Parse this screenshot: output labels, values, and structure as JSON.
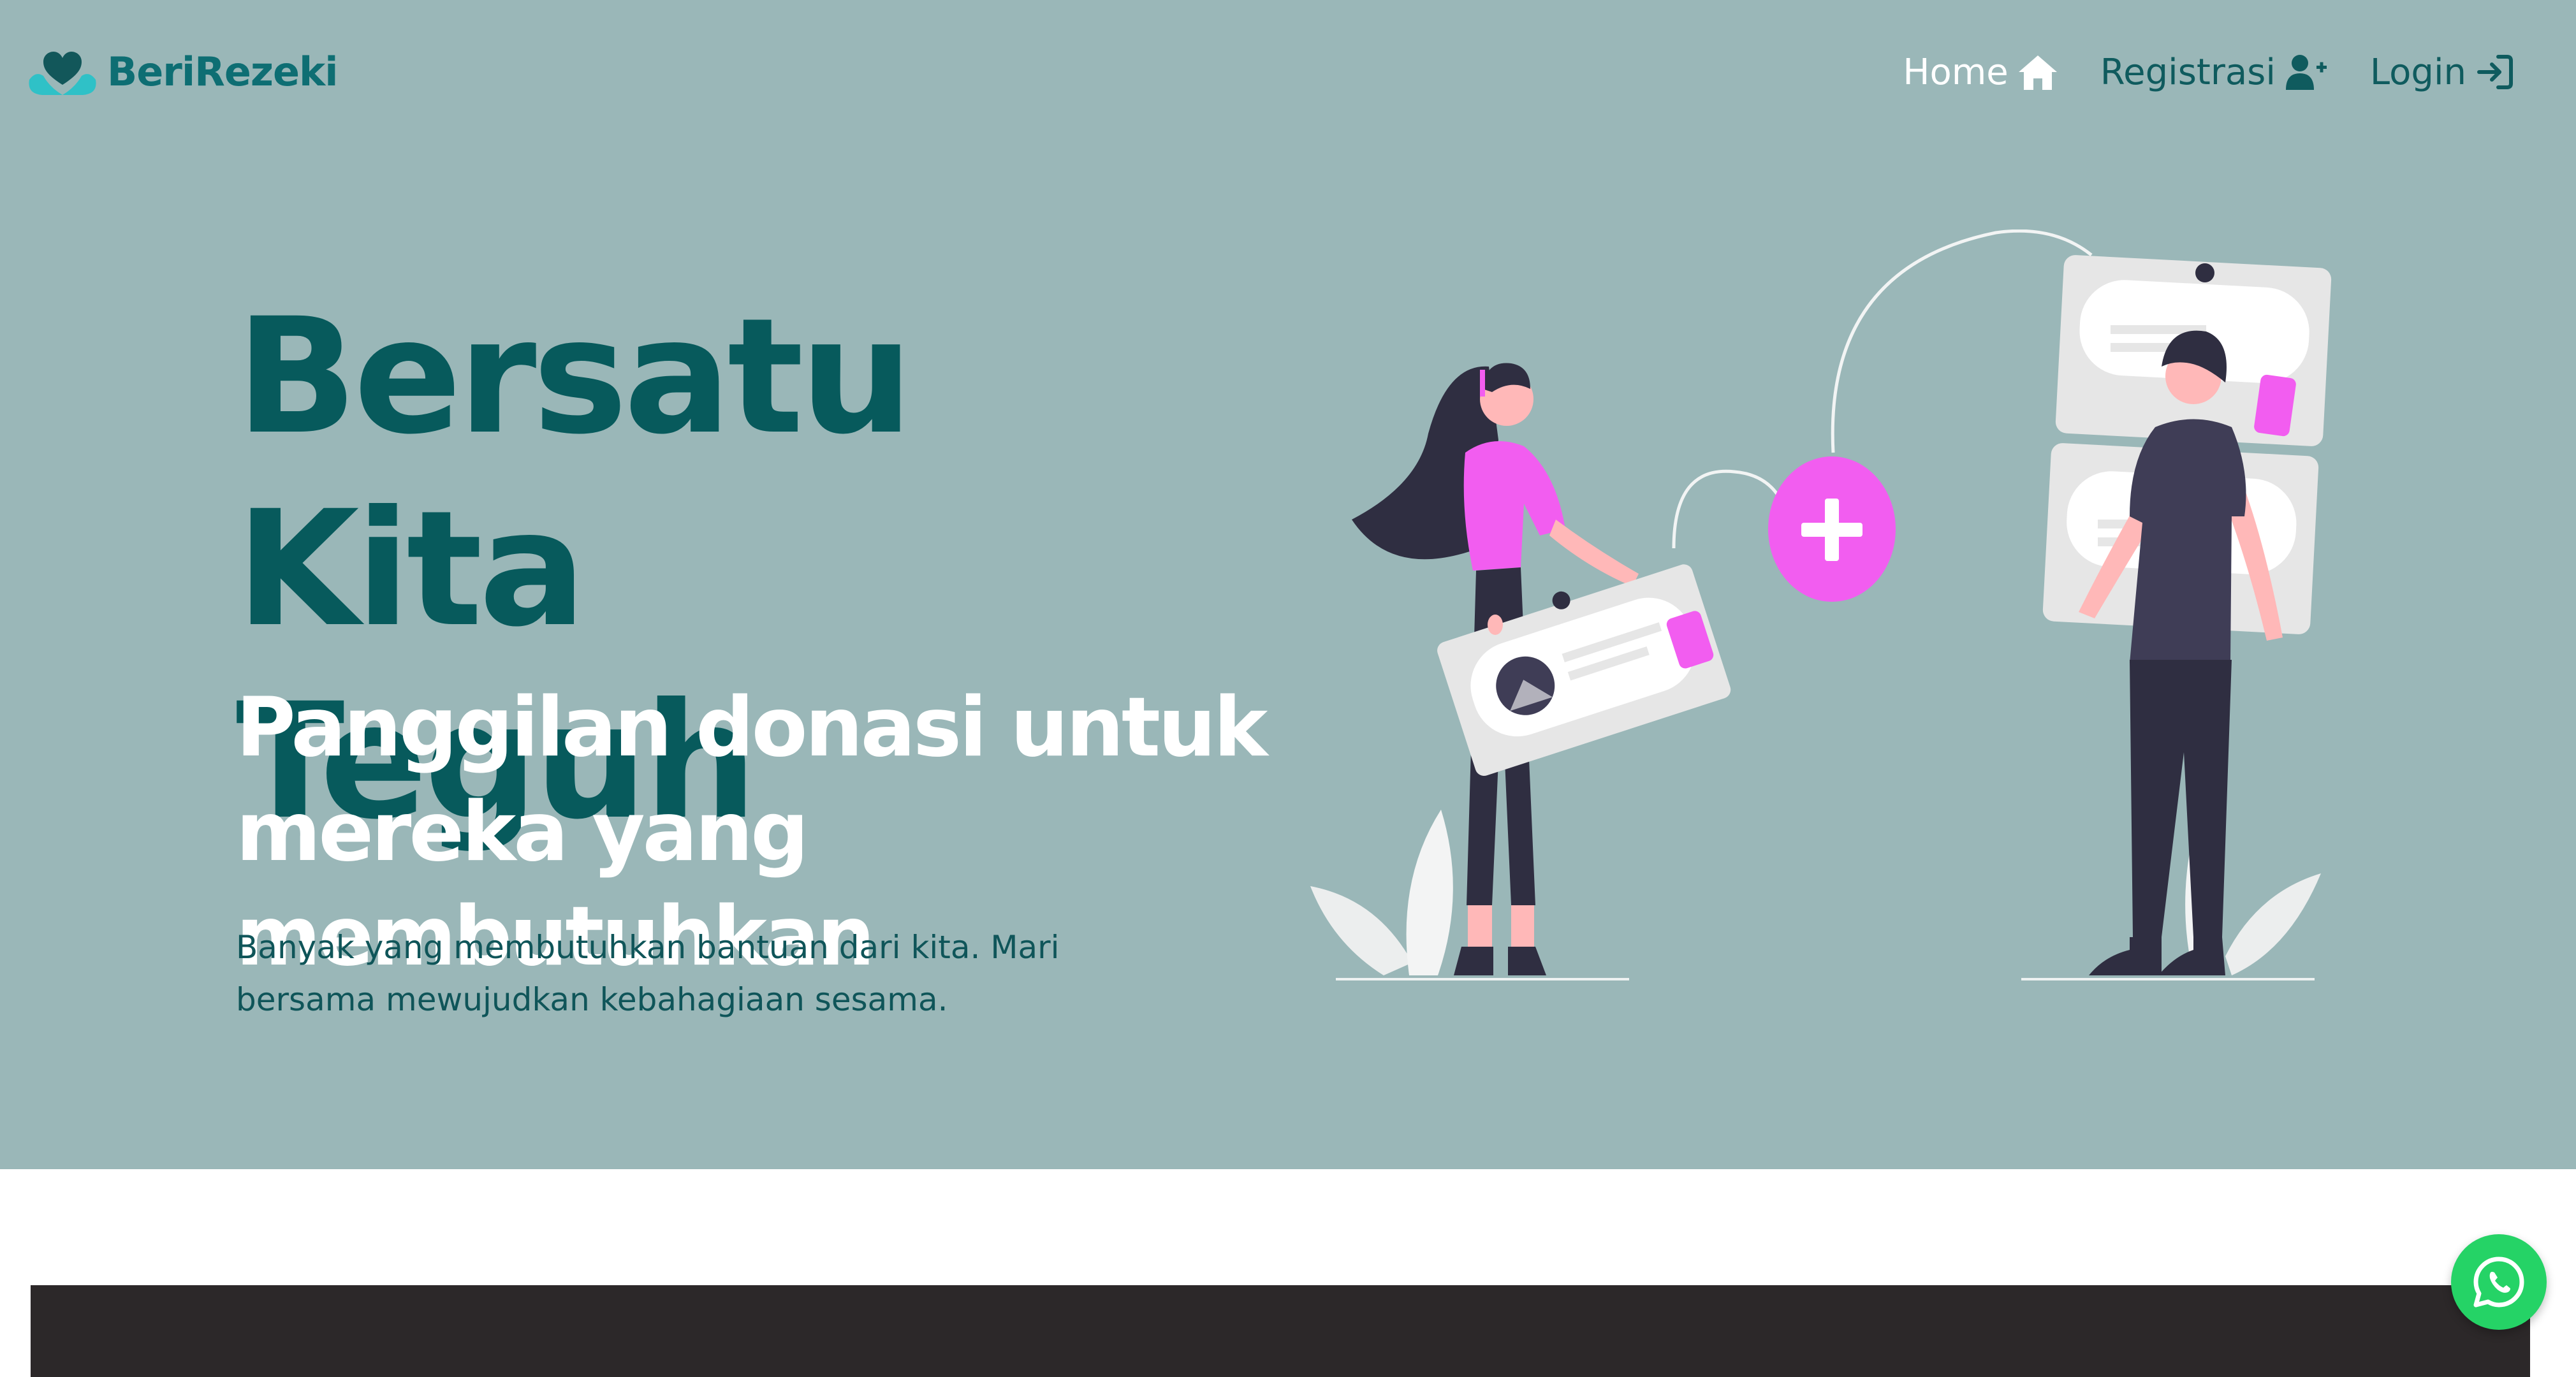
{
  "brand": {
    "name": "BeriRezeki",
    "icon": "heart-hands-icon"
  },
  "nav": {
    "items": [
      {
        "label": "Home",
        "icon": "home-icon",
        "active": true
      },
      {
        "label": "Registrasi",
        "icon": "user-plus-icon",
        "active": false
      },
      {
        "label": "Login",
        "icon": "login-icon",
        "active": false
      }
    ]
  },
  "hero": {
    "headline_line1": "Bersatu Kita",
    "headline_line2": "Teguh",
    "subheadline_line1": "Panggilan donasi untuk",
    "subheadline_line2": "mereka yang membutuhkan",
    "description": "Banyak yang membutuhkan bantuan dari kita. Mari bersama mewujudkan kebahagiaan sesama."
  },
  "floating": {
    "icon": "whatsapp-icon"
  },
  "colors": {
    "hero_bg": "#9ab7b8",
    "brand": "#0e6e73",
    "headline": "#075a5c",
    "accent_pink": "#f25df0",
    "dark_band": "#2c2829",
    "whatsapp": "#25d366"
  }
}
